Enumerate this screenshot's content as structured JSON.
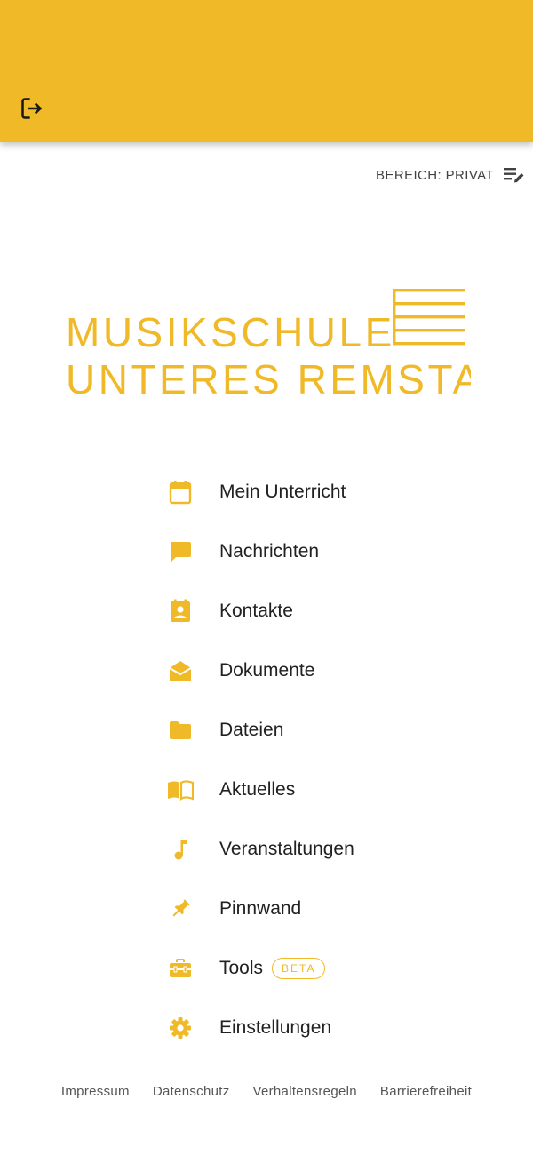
{
  "colors": {
    "accent": "#F0B928",
    "text": "#212121",
    "muted": "#555555"
  },
  "header": {
    "logout_icon": "logout-icon"
  },
  "area": {
    "label": "BEREICH: PRIVAT",
    "icon": "edit-list-icon"
  },
  "logo": {
    "line1": "MUSIKSCHULE",
    "line2": "UNTERES REMSTAL"
  },
  "menu": {
    "items": [
      {
        "label": "Mein Unterricht",
        "icon": "calendar-icon"
      },
      {
        "label": "Nachrichten",
        "icon": "chat-bubble-icon"
      },
      {
        "label": "Kontakte",
        "icon": "contact-card-icon"
      },
      {
        "label": "Dokumente",
        "icon": "open-envelope-icon"
      },
      {
        "label": "Dateien",
        "icon": "folder-icon"
      },
      {
        "label": "Aktuelles",
        "icon": "open-book-icon"
      },
      {
        "label": "Veranstaltungen",
        "icon": "music-note-icon"
      },
      {
        "label": "Pinnwand",
        "icon": "pushpin-icon"
      },
      {
        "label": "Tools",
        "icon": "toolbox-icon",
        "badge": "BETA"
      },
      {
        "label": "Einstellungen",
        "icon": "gear-icon"
      }
    ]
  },
  "footer": {
    "links": [
      "Impressum",
      "Datenschutz",
      "Verhaltensregeln",
      "Barrierefreiheit"
    ]
  }
}
